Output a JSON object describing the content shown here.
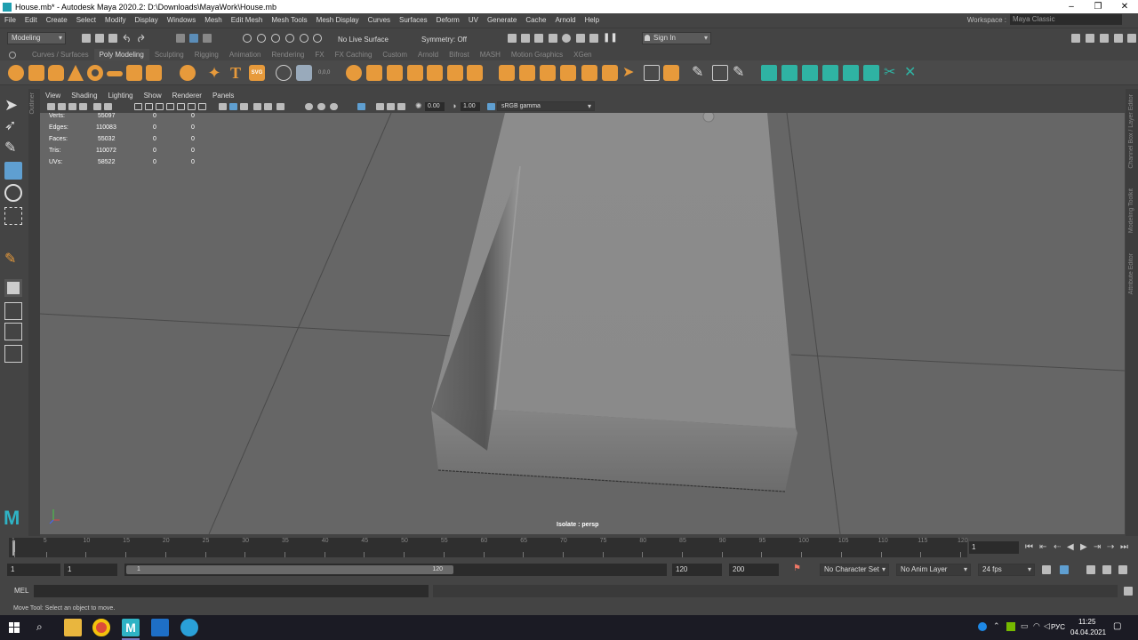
{
  "window": {
    "title": "House.mb* - Autodesk Maya 2020.2: D:\\Downloads\\MayaWork\\House.mb",
    "buttons": [
      "–",
      "❐",
      "✕"
    ]
  },
  "menubar": {
    "items": [
      "File",
      "Edit",
      "Create",
      "Select",
      "Modify",
      "Display",
      "Windows",
      "Mesh",
      "Edit Mesh",
      "Mesh Tools",
      "Mesh Display",
      "Curves",
      "Surfaces",
      "Deform",
      "UV",
      "Generate",
      "Cache",
      "Arnold",
      "Help"
    ],
    "workspace_label": "Workspace :",
    "workspace_value": "Maya Classic"
  },
  "statusline": {
    "mode": "Modeling",
    "live_surface": "No Live Surface",
    "symmetry": "Symmetry: Off",
    "sign_in": "Sign In"
  },
  "shelf": {
    "tabs": [
      "Curves / Surfaces",
      "Poly Modeling",
      "Sculpting",
      "Rigging",
      "Animation",
      "Rendering",
      "FX",
      "FX Caching",
      "Custom",
      "Arnold",
      "Bifrost",
      "MASH",
      "Motion Graphics",
      "XGen"
    ],
    "active_tab": "Poly Modeling",
    "text_tool_label": "T",
    "svg_tool_label": "SVG"
  },
  "outliner": {
    "label": "Outliner"
  },
  "panel": {
    "menus": [
      "View",
      "Shading",
      "Lighting",
      "Show",
      "Renderer",
      "Panels"
    ],
    "exposure": "0.00",
    "gamma": "1.00",
    "color_space": "sRGB gamma",
    "isolate_label": "Isolate : persp"
  },
  "hud": {
    "rows": [
      {
        "label": "Verts:",
        "a": "55097",
        "b": "0",
        "c": "0"
      },
      {
        "label": "Edges:",
        "a": "110083",
        "b": "0",
        "c": "0"
      },
      {
        "label": "Faces:",
        "a": "55032",
        "b": "0",
        "c": "0"
      },
      {
        "label": "Tris:",
        "a": "110072",
        "b": "0",
        "c": "0"
      },
      {
        "label": "UVs:",
        "a": "58522",
        "b": "0",
        "c": "0"
      }
    ]
  },
  "right_strip": [
    "Channel Box / Layer Editor",
    "Modeling Toolkit",
    "Attribute Editor"
  ],
  "timeline": {
    "ticks": [
      "1",
      "5",
      "10",
      "15",
      "20",
      "25",
      "30",
      "35",
      "40",
      "45",
      "50",
      "55",
      "60",
      "65",
      "70",
      "75",
      "80",
      "85",
      "90",
      "95",
      "100",
      "105",
      "110",
      "115",
      "120"
    ],
    "current_frame": "1"
  },
  "range": {
    "start": "1",
    "playback_start": "1",
    "slider_start": "1",
    "slider_end": "120",
    "playback_end": "120",
    "end": "200",
    "character_set": "No Character Set",
    "anim_layer": "No Anim Layer",
    "fps": "24 fps"
  },
  "cmd": {
    "label": "MEL"
  },
  "help": {
    "text": "Move Tool: Select an object to move."
  },
  "taskbar": {
    "lang": "РУС",
    "time": "11:25",
    "date": "04.04.2021"
  }
}
